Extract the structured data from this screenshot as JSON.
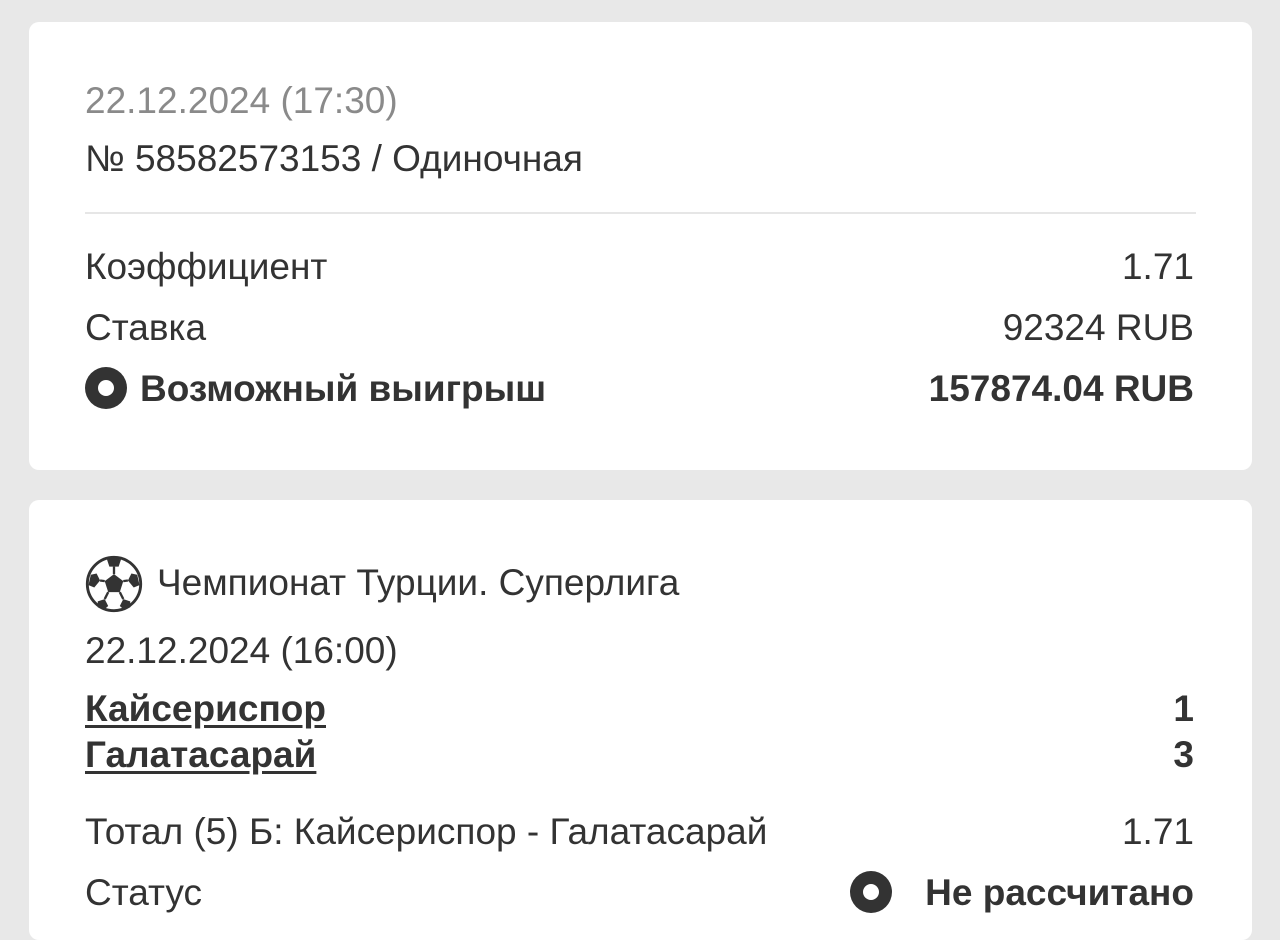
{
  "bet": {
    "datetime": "22.12.2024 (17:30)",
    "ticket": "№ 58582573153 / Одиночная",
    "coef_label": "Коэффициент",
    "coef_value": "1.71",
    "stake_label": "Ставка",
    "stake_value": "92324 RUB",
    "win_label": "Возможный выигрыш",
    "win_value": "157874.04 RUB"
  },
  "event": {
    "sport_icon": "soccer-ball-icon",
    "league": "Чемпионат Турции. Суперлига",
    "datetime": "22.12.2024 (16:00)",
    "teams": [
      {
        "name": "Кайсериспор",
        "score": "1"
      },
      {
        "name": "Галатасарай",
        "score": "3"
      }
    ],
    "market_label": "Тотал (5) Б: Кайсериспор - Галатасарай",
    "market_value": "1.71",
    "status_label": "Статус",
    "status_value": "Не рассчитано"
  },
  "colors": {
    "background": "#e8e8e8",
    "card": "#ffffff",
    "text": "#333333",
    "muted": "#8a8a8a"
  }
}
